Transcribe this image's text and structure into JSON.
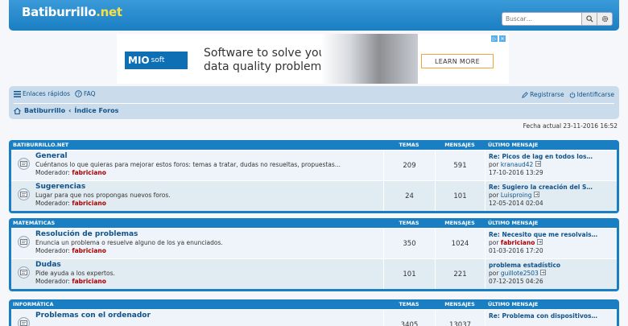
{
  "header": {
    "logo_main": "Batiburrillo",
    "logo_tld": ".net",
    "search_placeholder": "Buscar…"
  },
  "ad": {
    "brand": "MIO",
    "brand_suffix": "soft",
    "line1": "Software to solve your",
    "line2": "data quality problems.",
    "cta": "LEARN MORE"
  },
  "nav": {
    "quick_links": "Enlaces rápidos",
    "faq": "FAQ",
    "register": "Registrarse",
    "login": "Identificarse",
    "crumb_home": "Batiburrillo",
    "crumb_index": "Índice Foros"
  },
  "current_date": "Fecha actual 23-11-2016 16:52",
  "columns": {
    "topics": "TEMAS",
    "posts": "MENSAJES",
    "last_post": "ÚLTIMO MENSAJE"
  },
  "moderator_label": "Moderador:",
  "by_label": "por",
  "categories": [
    {
      "name": "BATIBURRILLO.NET",
      "forums": [
        {
          "title": "General",
          "desc": "Cuéntanos lo que quieras para mejorar estos foros: temas a tratar, dudas no resueltas, propuestas...",
          "moderator": "fabriciano",
          "topics": "209",
          "posts": "591",
          "last_title": "Re: Picos de lag en todos los…",
          "last_by": "kranaud42",
          "last_date": "17-10-2016 13:29"
        },
        {
          "title": "Sugerencias",
          "desc": "Lugar para que nos propongas nuevos foros.",
          "moderator": "fabriciano",
          "topics": "24",
          "posts": "101",
          "last_title": "Re: Sugiero la creación del S…",
          "last_by": "Luisproing",
          "last_date": "12-05-2014 02:04"
        }
      ]
    },
    {
      "name": "MATEMÁTICAS",
      "forums": [
        {
          "title": "Resolución de problemas",
          "desc": "Enuncia un problema o resuelve alguno de los ya enunciados.",
          "moderator": "fabriciano",
          "topics": "350",
          "posts": "1024",
          "last_title": "Re: Necesito que me resolvais…",
          "last_by": "fabriciano",
          "last_date": "01-03-2016 17:20"
        },
        {
          "title": "Dudas",
          "desc": "Pide ayuda a los expertos.",
          "moderator": "fabriciano",
          "topics": "101",
          "posts": "221",
          "last_title": "problema estadístico",
          "last_by": "guillote2503",
          "last_date": "07-12-2015 04:26"
        }
      ]
    },
    {
      "name": "INFORMÁTICA",
      "forums": [
        {
          "title": "Problemas con el ordenador",
          "desc": "",
          "moderator": "",
          "topics": "3405",
          "posts": "13037",
          "last_title": "Re: Problema con dispositivos…",
          "last_by": "",
          "last_date": ""
        }
      ]
    }
  ],
  "colors": {
    "header_blue": "#1a7ec2",
    "link": "#105289",
    "moderator": "#aa0000",
    "logo_tld": "#f3e14b"
  }
}
